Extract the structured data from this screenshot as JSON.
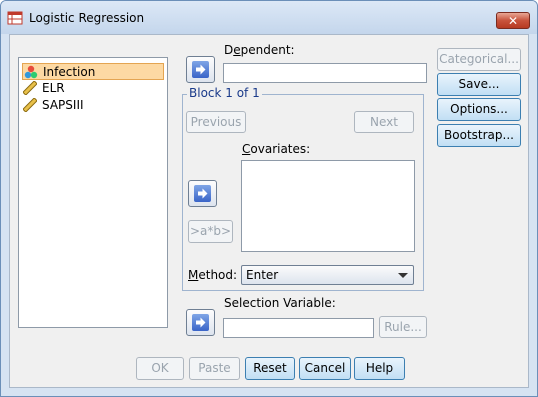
{
  "window": {
    "title": "Logistic Regression",
    "close_symbol": "✕"
  },
  "variables": [
    {
      "label": "Infection",
      "icon": "nominal-icon",
      "selected": true
    },
    {
      "label": "ELR",
      "icon": "scale-ruler-icon",
      "selected": false
    },
    {
      "label": "SAPSIII",
      "icon": "scale-ruler-icon",
      "selected": false
    }
  ],
  "dependent": {
    "label_pre": "D",
    "label_ul": "e",
    "label_post": "pendent:",
    "value": ""
  },
  "block": {
    "label": "Block 1 of 1",
    "previous_label": "Previous",
    "next_label": "Next",
    "interaction_label": ">a*b>"
  },
  "covariates": {
    "label_ul": "C",
    "label_post": "ovariates:"
  },
  "method": {
    "label_ul": "M",
    "label_post": "ethod:",
    "value": "Enter"
  },
  "selection_variable": {
    "label": "Selection Variable:",
    "value": "",
    "rule_label": "Rule..."
  },
  "side_buttons": {
    "categorical": "Categorical...",
    "save": "Save...",
    "options": "Options...",
    "bootstrap": "Bootstrap..."
  },
  "bottom_buttons": {
    "ok": "OK",
    "paste": "Paste",
    "reset": "Reset",
    "cancel": "Cancel",
    "help": "Help"
  },
  "colors": {
    "accent": "#3a64c8",
    "selection": "#fdd9a3",
    "group_title": "#1a3a8a"
  }
}
